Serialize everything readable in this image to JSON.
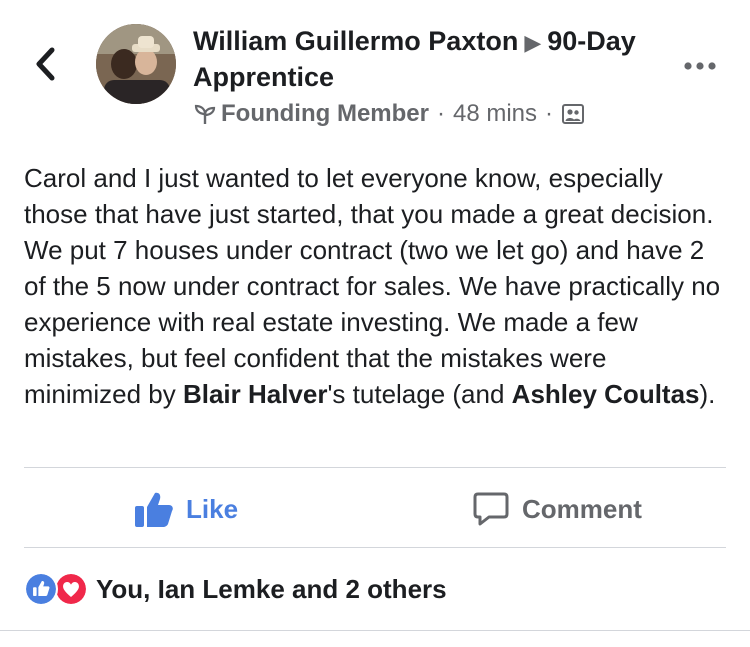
{
  "header": {
    "author": "William Guillermo Paxton",
    "group": "90-Day Apprentice",
    "badge_label": "Founding Member",
    "time": "48 mins",
    "separator_dot": "·",
    "icons": {
      "back": "chevron-left-icon",
      "badge": "sprout-icon",
      "privacy": "group-members-icon",
      "more": "ellipsis-icon"
    }
  },
  "post": {
    "text_intro": "Carol and I just wanted to let everyone know, especially those that have just started, that you made a great decision. We put 7 houses under contract (two we let go) and have 2 of the 5 now under contract for sales. We have practically no experience with real estate investing. We made a few mistakes, but feel confident that the mistakes were minimized by ",
    "mention_1": "Blair Halver",
    "text_mid": "'s tutelage (and ",
    "mention_2": "Ashley Coultas",
    "text_end": ")."
  },
  "actions": {
    "like_label": "Like",
    "comment_label": "Comment"
  },
  "reactions": {
    "summary": "You, Ian Lemke and 2 others",
    "types": [
      "like",
      "love"
    ]
  },
  "colors": {
    "like_blue": "#4a7fe0",
    "love_red": "#f0284a",
    "meta_gray": "#65676b",
    "text": "#1c1e21"
  }
}
